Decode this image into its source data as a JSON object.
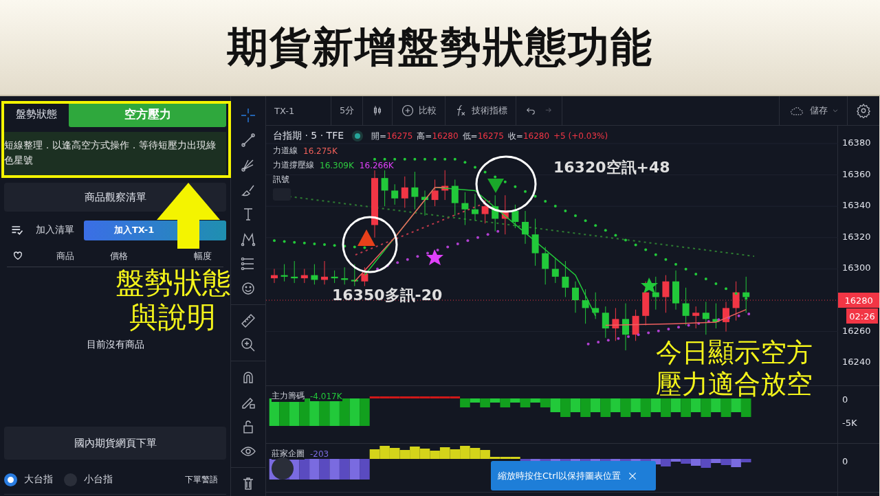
{
  "title": "期貨新增盤勢狀態功能",
  "side_panel": {
    "status_label": "盤勢狀態",
    "status_value": "空方壓力",
    "status_description": "短線整理．以逢高空方式操作．等待短壓力出現綠色星號",
    "watchlist_button": "商品觀察清單",
    "add_list_label": "加入清單",
    "add_button": "加入TX-1",
    "columns": [
      "商品",
      "價格",
      "幅度"
    ],
    "empty_text": "目前沒有商品",
    "order_button": "國內期貨網頁下單",
    "radios": [
      {
        "label": "大台指",
        "selected": true
      },
      {
        "label": "小台指",
        "selected": false
      }
    ],
    "warning_link": "下單警語"
  },
  "chart": {
    "toolbar": {
      "symbol": "TX-1",
      "interval": "5分",
      "compare": "比較",
      "indicators": "技術指標",
      "save": "儲存"
    },
    "legend": {
      "instrument": "台指期 · 5 · TFE",
      "ohlc": [
        {
          "label": "開=",
          "value": "16275"
        },
        {
          "label": "高=",
          "value": "16280"
        },
        {
          "label": "低=",
          "value": "16275"
        },
        {
          "label": "收=",
          "value": "16280"
        }
      ],
      "change": "+5 (+0.03%)"
    },
    "studies": [
      {
        "name": "力道線",
        "values": [
          {
            "text": "16.275K",
            "color": "#f0605a"
          }
        ]
      },
      {
        "name": "力道撐壓線",
        "values": [
          {
            "text": "16.309K",
            "color": "#2ecc40"
          },
          {
            "text": "16.266K",
            "color": "#e040fb"
          }
        ]
      },
      {
        "name": "訊號"
      }
    ],
    "price_ticks": [
      "16380",
      "16360",
      "16340",
      "16320",
      "16300",
      "16260",
      "16240"
    ],
    "last_price": "16280",
    "countdown": "02:26",
    "panes": [
      {
        "name": "主力籌碼",
        "value": "-4.017K",
        "ticks": [
          "0",
          "-5K"
        ]
      },
      {
        "name": "莊家企圖",
        "value": "-203",
        "ticks": [
          "0"
        ]
      }
    ],
    "toast": "縮放時按住Ctrl以保持圖表位置"
  },
  "annotations": {
    "status_note": [
      "盤勢狀態",
      "與說明"
    ],
    "short_signal": "16320空訊+48",
    "long_signal": "16350多訊-20",
    "conclusion": [
      "今日顯示空方",
      "壓力適合放空"
    ]
  }
}
